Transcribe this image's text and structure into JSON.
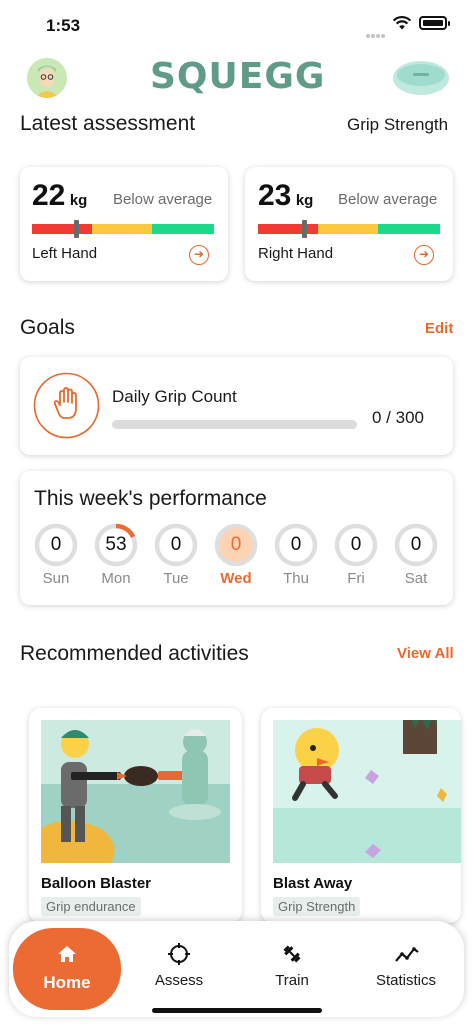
{
  "status_bar": {
    "time": "1:53"
  },
  "header": {
    "logo": "SQUEGG"
  },
  "assessment": {
    "title": "Latest assessment",
    "type_label": "Grip Strength",
    "left": {
      "value": "22",
      "unit": "kg",
      "rating": "Below average",
      "hand": "Left Hand",
      "marker_fraction": 0.23
    },
    "right": {
      "value": "23",
      "unit": "kg",
      "rating": "Below average",
      "hand": "Right Hand",
      "marker_fraction": 0.24
    },
    "bar_colors": [
      "#f23a35",
      "#fbc940",
      "#1fd98b"
    ]
  },
  "goals": {
    "title": "Goals",
    "edit_label": "Edit",
    "daily": {
      "title": "Daily Grip Count",
      "value": "0 / 300",
      "progress": 0
    }
  },
  "week": {
    "title": "This week's performance",
    "days": [
      {
        "label": "Sun",
        "value": "0",
        "progress": 0
      },
      {
        "label": "Mon",
        "value": "53",
        "progress": 0.18
      },
      {
        "label": "Tue",
        "value": "0",
        "progress": 0
      },
      {
        "label": "Wed",
        "value": "0",
        "progress": 0,
        "today": true
      },
      {
        "label": "Thu",
        "value": "0",
        "progress": 0
      },
      {
        "label": "Fri",
        "value": "0",
        "progress": 0
      },
      {
        "label": "Sat",
        "value": "0",
        "progress": 0
      }
    ]
  },
  "activities": {
    "title": "Recommended activities",
    "view_all_label": "View All",
    "items": [
      {
        "title": "Balloon Blaster",
        "tag": "Grip endurance"
      },
      {
        "title": "Blast Away",
        "tag": "Grip Strength"
      }
    ]
  },
  "nav": {
    "home": "Home",
    "assess": "Assess",
    "train": "Train",
    "statistics": "Statistics"
  },
  "colors": {
    "accent": "#ec6b32",
    "brand": "#5f9b87"
  }
}
